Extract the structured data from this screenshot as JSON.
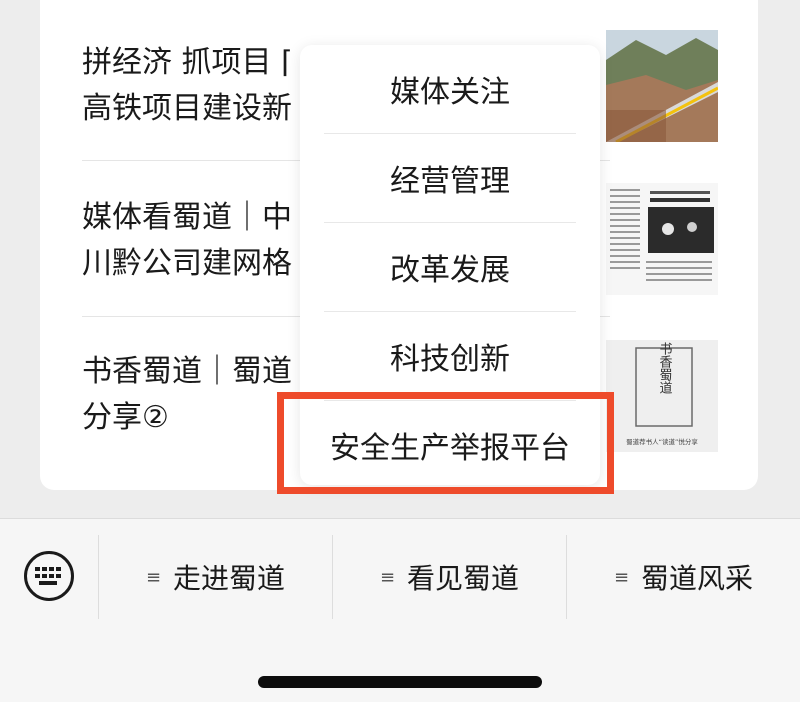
{
  "articles": [
    {
      "title": "拼经济 抓项目 ⌈\n高铁项目建设新",
      "thumb_icon": "railway-landscape-image"
    },
    {
      "title": "媒体看蜀道｜中\n川黔公司建网格",
      "thumb_icon": "newspaper-clipping-image"
    },
    {
      "title": "书香蜀道｜蜀道\n分享②",
      "thumb_icon": "book-fragrance-poster-image"
    }
  ],
  "thumb_text": {
    "poster_main": "书香蜀道",
    "poster_caption": "蜀道荐书人“读道”悦分享"
  },
  "menu": {
    "items": [
      "媒体关注",
      "经营管理",
      "改革发展",
      "科技创新",
      "安全生产举报平台"
    ],
    "highlight_color": "#ee4b2b"
  },
  "bottom_bar": {
    "keyboard_icon": "keyboard-icon",
    "tabs": [
      "走进蜀道",
      "看见蜀道",
      "蜀道风采"
    ],
    "tab_icon": "hamburger-icon"
  }
}
